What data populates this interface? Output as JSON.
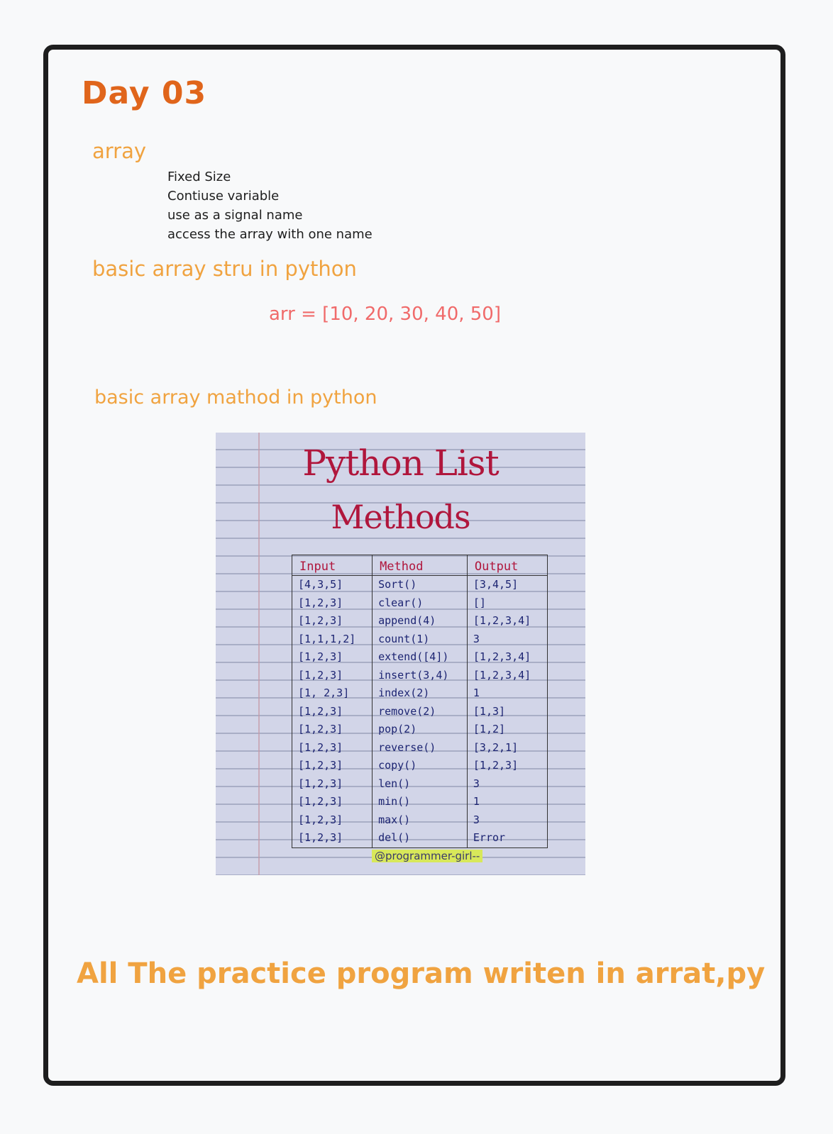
{
  "page": {
    "title": "Day 03",
    "array_heading": "array",
    "array_points": [
      "Fixed Size",
      "Contiuse variable",
      "use as a signal name",
      "access the array with one name"
    ],
    "structure_heading": "basic array stru in python",
    "code_example": "arr = [10, 20, 30, 40, 50]",
    "method_heading": "basic array mathod in python",
    "footer_note": "All The practice program writen in arrat,py"
  },
  "notebook_image": {
    "title_line1": "Python List",
    "title_line2": "Methods",
    "columns": [
      "Input",
      "Method",
      "Output"
    ],
    "rows": [
      [
        "[4,3,5]",
        "Sort()",
        "[3,4,5]"
      ],
      [
        "[1,2,3]",
        "clear()",
        "[]"
      ],
      [
        "[1,2,3]",
        "append(4)",
        "[1,2,3,4]"
      ],
      [
        "[1,1,1,2]",
        "count(1)",
        "3"
      ],
      [
        "[1,2,3]",
        "extend([4])",
        "[1,2,3,4]"
      ],
      [
        "[1,2,3]",
        "insert(3,4)",
        "[1,2,3,4]"
      ],
      [
        "[1, 2,3]",
        "index(2)",
        "1"
      ],
      [
        "[1,2,3]",
        "remove(2)",
        "[1,3]"
      ],
      [
        "[1,2,3]",
        "pop(2)",
        "[1,2]"
      ],
      [
        "[1,2,3]",
        "reverse()",
        "[3,2,1]"
      ],
      [
        "[1,2,3]",
        "copy()",
        "[1,2,3]"
      ],
      [
        "[1,2,3]",
        "len()",
        "3"
      ],
      [
        "[1,2,3]",
        "min()",
        "1"
      ],
      [
        "[1,2,3]",
        "max()",
        "3"
      ],
      [
        "[1,2,3]",
        "del()",
        "Error"
      ]
    ],
    "watermark": "@programmer-girl--"
  }
}
